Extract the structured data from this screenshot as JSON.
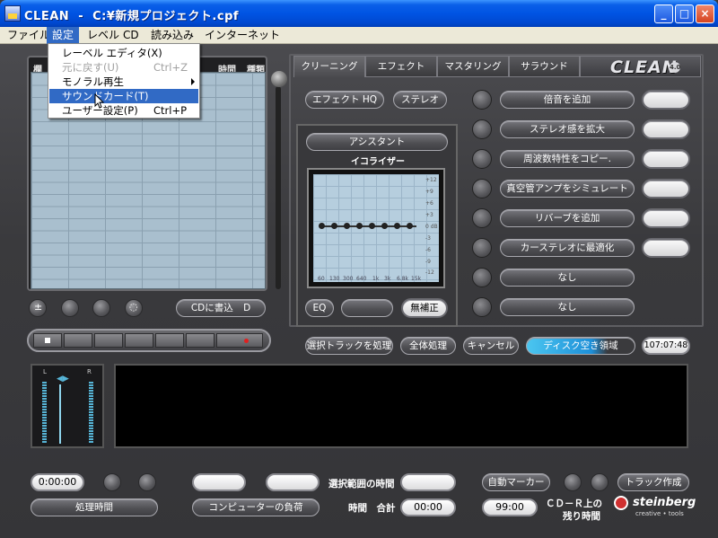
{
  "window": {
    "title": "CLEAN  -  C:¥新規プロジェクト.cpf",
    "minimize": "_",
    "maximize": "□",
    "close": "×"
  },
  "menubar": {
    "items": [
      "ファイル",
      "設定",
      "レベル",
      "CD",
      "読み込み",
      "インターネット"
    ],
    "active": "設定"
  },
  "dropdown": {
    "items": [
      {
        "label": "レーベル エディタ(X)",
        "shortcut": "",
        "disabled": false
      },
      {
        "label": "元に戻す(U)",
        "shortcut": "Ctrl+Z",
        "disabled": true
      },
      {
        "label": "モノラル再生",
        "shortcut": "",
        "disabled": false,
        "submenu": true
      },
      {
        "label": "サウンドカード(T)",
        "shortcut": "",
        "disabled": false,
        "highlighted": true
      },
      {
        "label": "ユーザー設定(P)",
        "shortcut": "Ctrl+P",
        "disabled": false
      }
    ]
  },
  "track_list": {
    "headers": [
      "欄",
      "時間",
      "種類"
    ]
  },
  "left_controls": {
    "cd_write": "CDに書込",
    "cd_write_sub": "D"
  },
  "tabs": [
    "クリーニング",
    "エフェクト",
    "マスタリング",
    "サラウンド"
  ],
  "brand": {
    "name": "CLEAN",
    "version": "4.0"
  },
  "cleaning": {
    "effect_hq": "エフェクト HQ",
    "stereo": "ステレオ",
    "assistant": "アシスタント",
    "equalizer": "イコライザー",
    "eq_button": "EQ",
    "no_correction": "無補正",
    "eq_db_labels": [
      "+12",
      "+9",
      "+6",
      "+3",
      "0 dB",
      "-3",
      "-6",
      "-9",
      "-12"
    ],
    "eq_freq_labels": [
      "60",
      "130",
      "300",
      "640",
      "1k",
      "3k",
      "6.8k",
      "15k"
    ],
    "effects": [
      "倍音を追加",
      "ステレオ感を拡大",
      "周波数特性をコピー.",
      "真空管アンプをシミュレート",
      "リバーブを追加",
      "カーステレオに最適化",
      "なし",
      "なし"
    ]
  },
  "actions": {
    "process_selected": "選択トラックを処理",
    "process_all": "全体処理",
    "cancel": "キャンセル",
    "disk_space": "ディスク空き領域",
    "disk_time": "107:07:48"
  },
  "meter": {
    "left": "L",
    "right": "R"
  },
  "footer": {
    "time_display": "0:00:00",
    "processing_time": "処理時間",
    "computer_load": "コンピューターの負荷",
    "selection_time": "選択範囲の時間",
    "time_total": "時間　合計",
    "total_display": "00:00",
    "cdr_display": "99:00",
    "cdr_remaining": "ＣＤ－Ｒ上の",
    "cdr_remaining2": "残り時間",
    "auto_marker": "自動マーカー",
    "make_track": "トラック作成",
    "steinberg": "steinberg",
    "steinberg_sub": "creative • tools"
  }
}
